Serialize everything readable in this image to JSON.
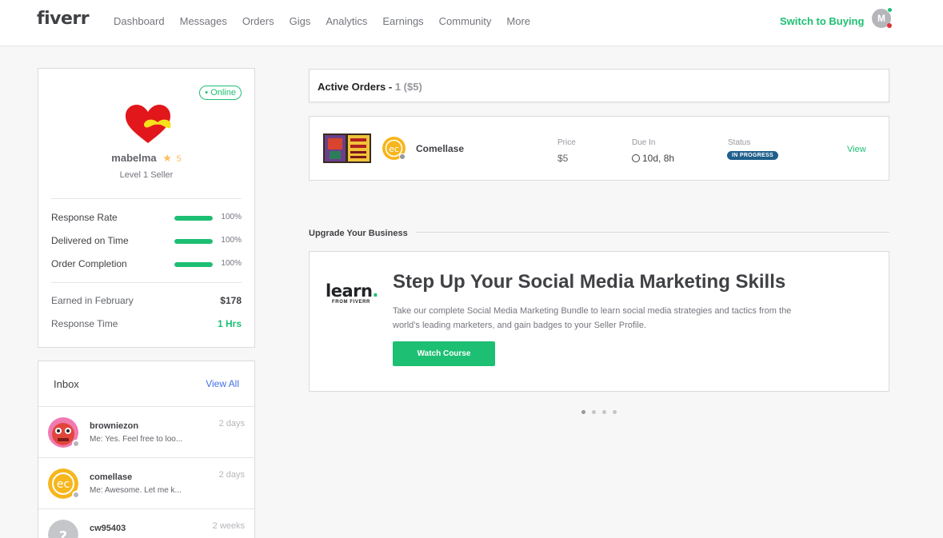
{
  "header": {
    "logo": "fiverr",
    "nav": [
      "Dashboard",
      "Messages",
      "Orders",
      "Gigs",
      "Analytics",
      "Earnings",
      "Community",
      "More"
    ],
    "switch_label": "Switch to Buying",
    "avatar_initial": "M"
  },
  "profile": {
    "status": "• Online",
    "username": "mabelma",
    "rating": "5",
    "level": "Level 1 Seller",
    "stats": [
      {
        "label": "Response Rate",
        "percent": 100,
        "value": "100%"
      },
      {
        "label": "Delivered on Time",
        "percent": 100,
        "value": "100%"
      },
      {
        "label": "Order Completion",
        "percent": 100,
        "value": "100%"
      }
    ],
    "earned_label": "Earned in February",
    "earned_value": "$178",
    "response_time_label": "Response Time",
    "response_time_value": "1 Hrs"
  },
  "inbox": {
    "title": "Inbox",
    "view_all": "View All",
    "messages": [
      {
        "user": "browniezon",
        "text": "Me: Yes. Feel free to loo...",
        "time": "2 days"
      },
      {
        "user": "comellase",
        "text": "Me: Awesome. Let me k...",
        "time": "2 days"
      },
      {
        "user": "cw95403",
        "text": "",
        "time": "2 weeks"
      }
    ]
  },
  "orders": {
    "title": "Active Orders - ",
    "count": "1 ($5)",
    "items": [
      {
        "seller": "Comellase",
        "price_label": "Price",
        "price": "$5",
        "due_label": "Due In",
        "due": "10d, 8h",
        "status_label": "Status",
        "status": "IN PROGRESS",
        "action": "View"
      }
    ]
  },
  "upgrade": {
    "section_title": "Upgrade Your Business",
    "logo_word": "learn",
    "logo_sub": "FROM FIVERR",
    "heading": "Step Up Your Social Media Marketing Skills",
    "body": "Take our complete Social Media Marketing Bundle to learn social media strategies and tactics from the world's leading marketers, and gain badges to your Seller Profile.",
    "button": "Watch Course",
    "carousel_pages": 4,
    "carousel_active": 1
  },
  "colors": {
    "brand_green": "#1dbf73",
    "link_blue": "#446ee7",
    "status_blue": "#1f5f8b",
    "star": "#ffbe5b"
  }
}
